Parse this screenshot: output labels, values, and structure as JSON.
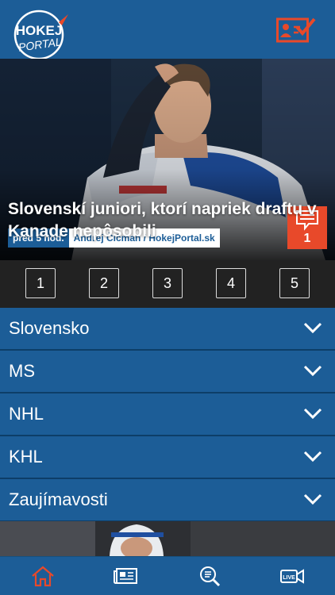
{
  "app": {
    "logo_text_top": "HOKEJ",
    "logo_text_bottom": "PORTAL",
    "brand_color": "#1c5d97",
    "accent_color": "#e8492a",
    "vote_icon": "vote-check-icon"
  },
  "hero": {
    "time": "pred 5 hod.",
    "author": "Andrej Čičman / HokejPortal.sk",
    "title": "Slovenskí juniori, ktorí napriek draftu v Kanade nepôsobili",
    "comment_count": "1"
  },
  "pager": [
    "1",
    "2",
    "3",
    "4",
    "5"
  ],
  "sections": [
    {
      "label": "Slovensko"
    },
    {
      "label": "MS"
    },
    {
      "label": "NHL"
    },
    {
      "label": "KHL"
    },
    {
      "label": "Zaujímavosti"
    }
  ],
  "bottom_nav": {
    "items": [
      {
        "icon": "home-icon",
        "active": true
      },
      {
        "icon": "news-icon",
        "active": false
      },
      {
        "icon": "search-list-icon",
        "active": false
      },
      {
        "icon": "live-video-icon",
        "active": false
      }
    ],
    "live_label": "LIVE"
  }
}
